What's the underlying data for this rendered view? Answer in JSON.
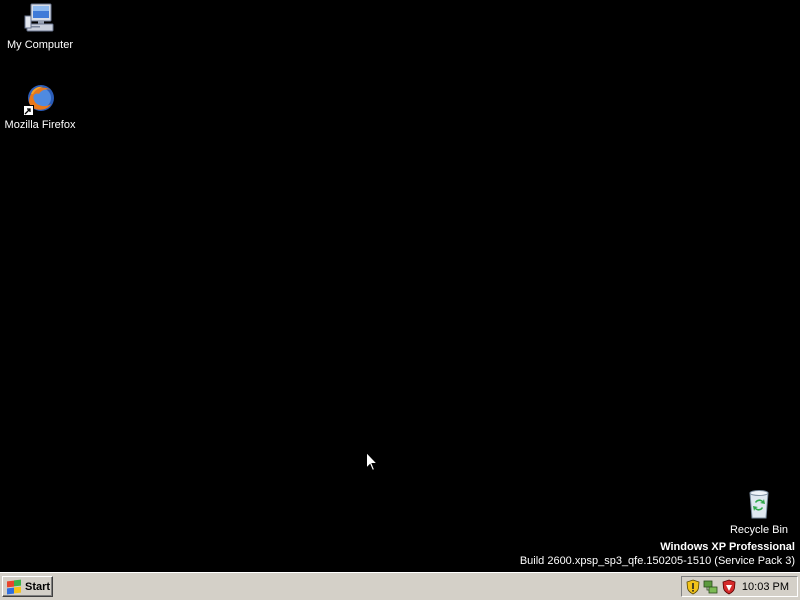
{
  "desktop": {
    "background_color": "#000000",
    "icons": [
      {
        "label": "My Computer",
        "icon": "my-computer-icon"
      },
      {
        "label": "Mozilla Firefox",
        "icon": "firefox-icon",
        "shortcut": true
      },
      {
        "label": "Recycle Bin",
        "icon": "recycle-bin-icon"
      }
    ],
    "watermark": {
      "edition": "Windows XP Professional",
      "build": "Build 2600.xpsp_sp3_qfe.150205-1510 (Service Pack 3)"
    }
  },
  "taskbar": {
    "background_color": "#d4d0c8",
    "start_label": "Start",
    "tray_icons": [
      "security-center-shield-icon",
      "network-icon",
      "antivirus-shield-icon"
    ],
    "clock": "10:03 PM"
  }
}
